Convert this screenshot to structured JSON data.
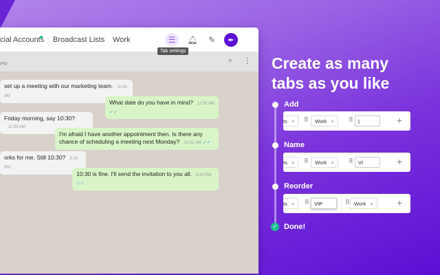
{
  "app": {
    "tabs": [
      {
        "label": "cial Accounts",
        "unread": true
      },
      {
        "label": "Broadcast Lists"
      },
      {
        "label": "Work"
      }
    ],
    "icons": [
      "sliders-icon",
      "bell-icon",
      "edit-icon",
      "avatar"
    ],
    "tooltip": "Tab settings",
    "chat_time": "PM",
    "messages": [
      {
        "dir": "in",
        "text": "set up a meeting with our marketing team.",
        "time": "11:45 AM"
      },
      {
        "dir": "out",
        "text": "What date do you have in mind?",
        "time": "11:50 AM"
      },
      {
        "dir": "in",
        "text": "Friday morning, say 10:30?",
        "time": "11:52 AM"
      },
      {
        "dir": "out",
        "text": "I'm afraid I have another appointment then. Is there any chance of scheduling a meeting next Monday?",
        "time": "12:31 AM"
      },
      {
        "dir": "in",
        "text": "orks for me. Still 10:30?",
        "time": "3:16 PM"
      },
      {
        "dir": "out",
        "text": "10:30 is fine. I'll send the invitation to you all.",
        "time": "5:04 PM"
      }
    ]
  },
  "promo": {
    "headline": "Create as many tabs as you like",
    "steps": [
      {
        "label": "Add"
      },
      {
        "label": "Name"
      },
      {
        "label": "Reorder"
      },
      {
        "label": "Done!"
      }
    ],
    "chips": {
      "partial": "ts",
      "work": "Work",
      "name_value": "VI",
      "reorder_value": "VIP",
      "close": "×",
      "plus": "+",
      "handle": "⠿"
    }
  },
  "colors": {
    "accent": "#5b12d6",
    "online": "#19c39a",
    "done": "#1bbf93"
  }
}
